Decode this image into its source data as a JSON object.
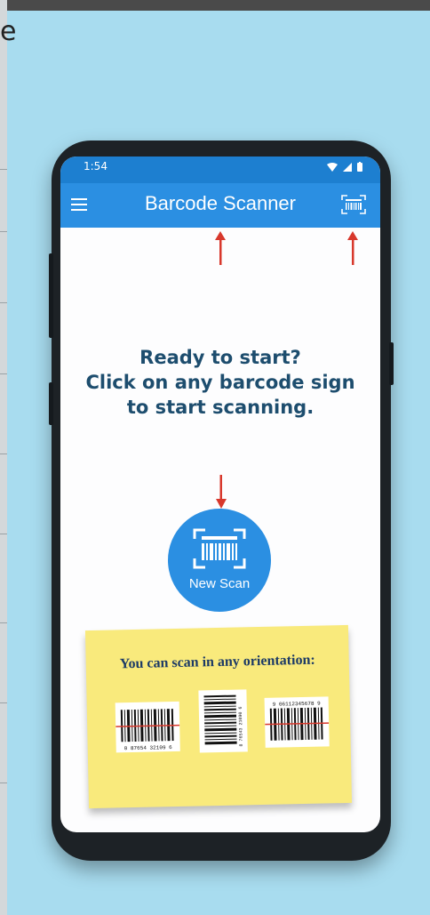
{
  "status_bar": {
    "time": "1:54"
  },
  "appbar": {
    "title": "Barcode Scanner"
  },
  "prompt": {
    "line1": "Ready to start?",
    "line2": "Click on any barcode sign",
    "line3": "to start scanning."
  },
  "new_scan": {
    "label": "New Scan"
  },
  "note": {
    "text": "You can scan in any orientation:",
    "barcodes": [
      "0 87654 32109 6",
      "8 76543 21090 6",
      "9 06112345678 9"
    ]
  },
  "colors": {
    "appbar": "#2b8fe2",
    "status_bar": "#1d7fd0",
    "background": "#a8dcef",
    "prompt_text": "#1d4d6e",
    "note": "#f9ea7c",
    "arrow": "#d8382c"
  }
}
